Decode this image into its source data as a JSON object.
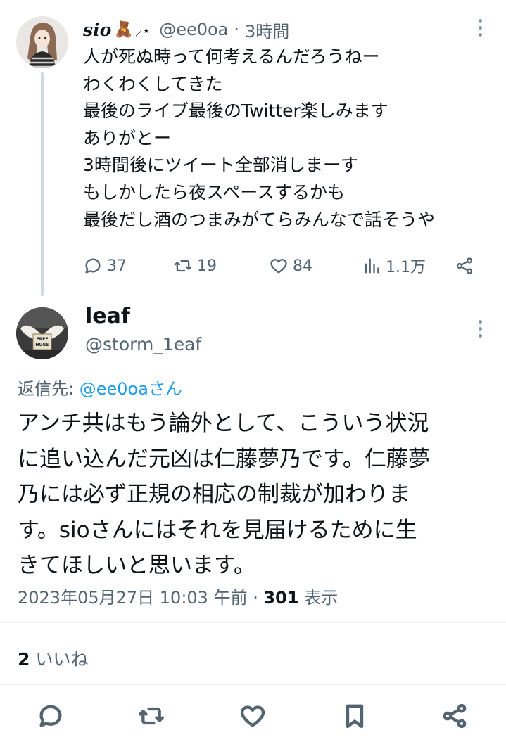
{
  "parent_tweet": {
    "display_name": "sio",
    "name_emoji": "🧸",
    "name_decoration": "⸝⋆",
    "handle": "@ee0oa",
    "separator": "·",
    "time": "3時間",
    "lines": [
      "人が死ぬ時って何考えるんだろうねー",
      "わくわくしてきた",
      "最後のライブ最後のTwitter楽しみます",
      "ありがとー",
      "3時間後にツイート全部消しまーす",
      "もしかしたら夜スペースするかも",
      "最後だし酒のつまみがてらみんなで話そうや"
    ],
    "actions": {
      "reply_count": "37",
      "retweet_count": "19",
      "like_count": "84",
      "view_count": "1.1万"
    }
  },
  "reply_tweet": {
    "display_name": "leaf",
    "handle": "@storm_1eaf",
    "avatar_sign_text": "FREE HUGS",
    "reply_to_label": "返信先: ",
    "reply_to_mention": "@ee0oaさん",
    "lines": [
      "アンチ共はもう論外として、こういう状況",
      "に追い込んだ元凶は仁藤夢乃です。仁藤夢",
      "乃には必ず正規の相応の制裁が加わりま",
      "す。sioさんにはそれを見届けるために生",
      "きてほしいと思います。"
    ],
    "meta": {
      "timestamp": "2023年05月27日 10:03 午前",
      "separator": " · ",
      "views": "301",
      "views_label": " 表示"
    },
    "likes": {
      "count": "2",
      "label": " いいね"
    }
  },
  "icons": {
    "more": "more-dots-icon",
    "reply": "reply-bubble-icon",
    "retweet": "retweet-arrows-icon",
    "like": "heart-icon",
    "views": "bar-chart-icon",
    "share": "share-nodes-icon",
    "bookmark": "bookmark-icon"
  },
  "colors": {
    "text": "#0f1419",
    "muted": "#536471",
    "link": "#1d9bf0",
    "thread_line": "#cfd9de",
    "divider": "#eff3f4"
  }
}
